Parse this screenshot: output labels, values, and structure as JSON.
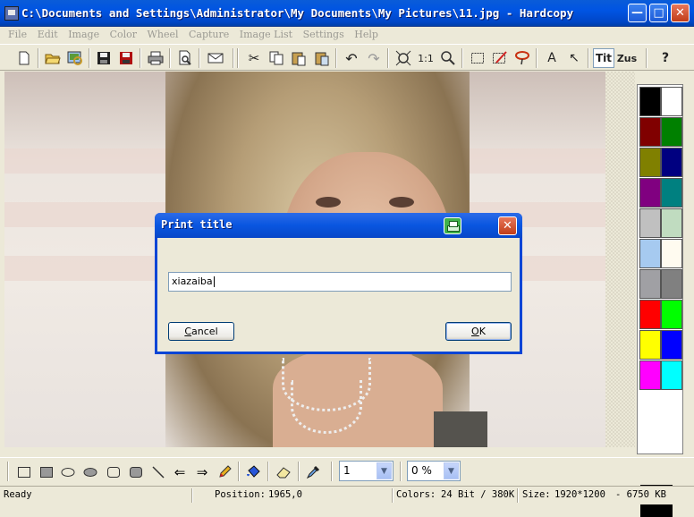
{
  "window": {
    "title": "C:\\Documents and Settings\\Administrator\\My Documents\\My Pictures\\11.jpg - Hardcopy",
    "minimize_icon": "minimize-icon",
    "maximize_icon": "maximize-icon",
    "close_icon": "close-icon"
  },
  "menu": {
    "items": [
      "File",
      "Edit",
      "Image",
      "Color",
      "Wheel",
      "Capture",
      "Image List",
      "Settings",
      "Help"
    ]
  },
  "toolbar": {
    "zoom_actual_label": "1:1",
    "text_title_label": "Tit",
    "text_zus_label": "Zus",
    "help_label": "?",
    "text_a_label": "A"
  },
  "dialog": {
    "title": "Print title",
    "input_value": "xiazaiba",
    "cancel_label": "Cancel",
    "cancel_mnemonic": "C",
    "cancel_rest": "ancel",
    "ok_label": "OK",
    "ok_mnemonic": "O",
    "ok_rest": "K"
  },
  "palette": {
    "colors": [
      "#000000",
      "#ffffff",
      "#800000",
      "#008000",
      "#808000",
      "#000080",
      "#800080",
      "#008080",
      "#c0c0c0",
      "#c0dcc0",
      "#a6caf0",
      "#fffbf0",
      "#a0a0a4",
      "#808080",
      "#ff0000",
      "#00ff00",
      "#ffff00",
      "#0000ff",
      "#ff00ff",
      "#00ffff"
    ],
    "foreground": "#000000",
    "background": "#ffffff"
  },
  "bottom_tools": {
    "line_width_value": "1",
    "transparency_value": "0 %"
  },
  "status": {
    "state": "Ready",
    "position_label": "Position:",
    "position_value": "1965,0",
    "colors_label": "Colors:",
    "colors_value": "24 Bit / 380K",
    "size_label": "Size:",
    "size_value": "1920*1200",
    "filesize_value": "- 6750 KB"
  }
}
